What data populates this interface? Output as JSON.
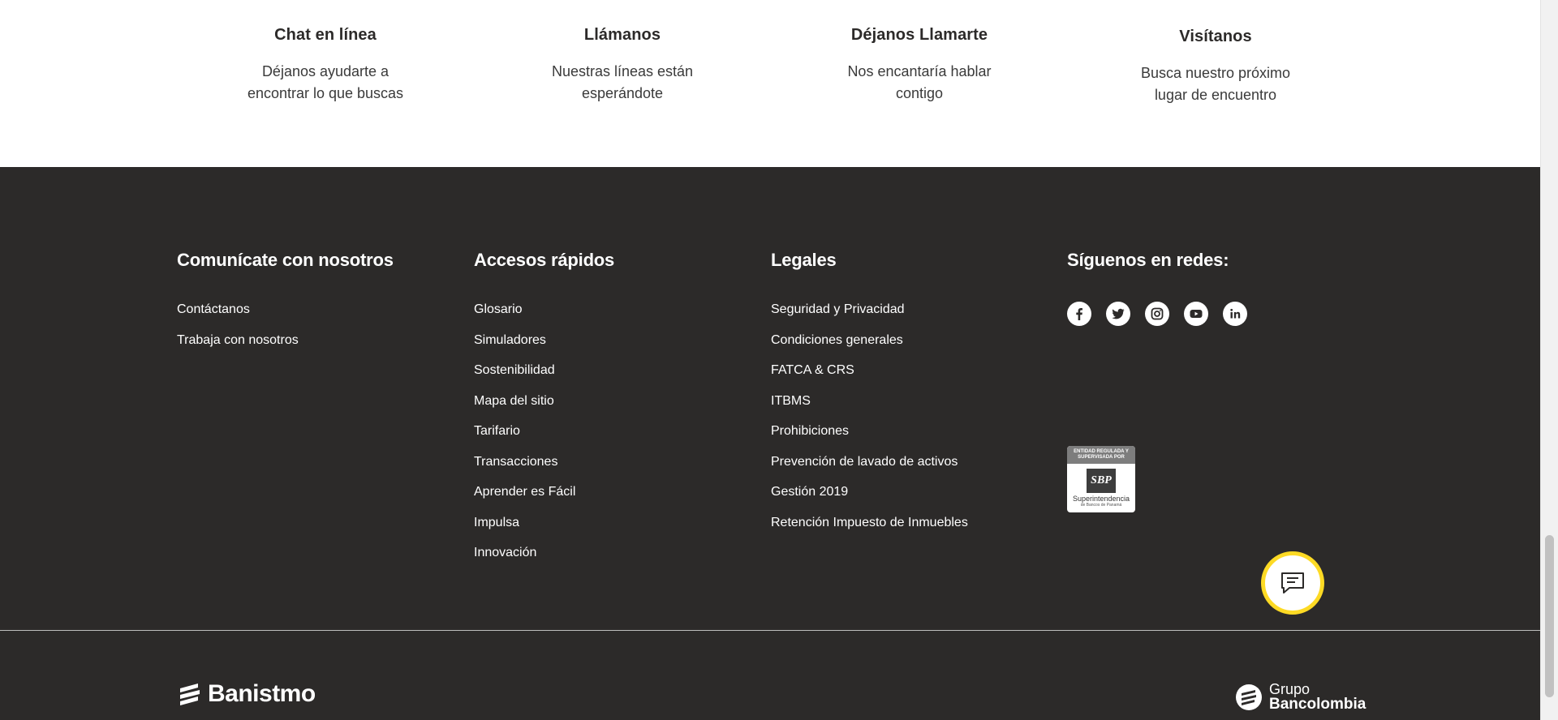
{
  "contact_strip": {
    "items": [
      {
        "title": "Chat en línea",
        "line1": "Déjanos ayudarte a",
        "line2": "encontrar lo que buscas"
      },
      {
        "title": "Llámanos",
        "line1": "Nuestras líneas están",
        "line2": "esperándote"
      },
      {
        "title": "Déjanos Llamarte",
        "line1": "Nos encantaría hablar",
        "line2": "contigo"
      },
      {
        "title": "Visítanos",
        "line1": "Busca nuestro próximo",
        "line2": "lugar de encuentro"
      }
    ]
  },
  "footer": {
    "contact": {
      "heading": "Comunícate con nosotros",
      "links": [
        "Contáctanos",
        "Trabaja con nosotros"
      ]
    },
    "quick_access": {
      "heading": "Accesos rápidos",
      "links": [
        "Glosario",
        "Simuladores",
        "Sostenibilidad",
        "Mapa del sitio",
        "Tarifario",
        "Transacciones",
        "Aprender es Fácil",
        "Impulsa",
        "Innovación"
      ]
    },
    "legal": {
      "heading": "Legales",
      "links": [
        "Seguridad y Privacidad",
        "Condiciones generales",
        "FATCA & CRS",
        "ITBMS",
        "Prohibiciones",
        "Prevención de lavado de activos",
        "Gestión 2019",
        "Retención Impuesto de Inmuebles"
      ]
    },
    "social": {
      "heading": "Síguenos en redes:",
      "icons": [
        "facebook-icon",
        "twitter-icon",
        "instagram-icon",
        "youtube-icon",
        "linkedin-icon"
      ]
    },
    "regulator_badge": {
      "top_line1": "ENTIDAD REGULADA Y",
      "top_line2": "SUPERVISADA POR",
      "logo": "SBP",
      "name": "Superintendencia",
      "sub": "de Bancos de Panamá"
    },
    "brand": "Banistmo",
    "group": {
      "line1": "Grupo",
      "line2": "Bancolombia"
    }
  },
  "colors": {
    "footer_bg": "#2c2a29",
    "accent_yellow": "#fdda24",
    "text_dark": "#2c2a29"
  }
}
